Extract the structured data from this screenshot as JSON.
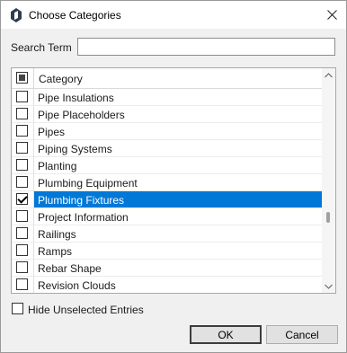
{
  "window": {
    "title": "Choose Categories",
    "icon": "app-logo-icon",
    "close_icon": "close-icon"
  },
  "search": {
    "label": "Search Term",
    "value": ""
  },
  "list": {
    "header": {
      "select_all_state": "indeterminate",
      "column_label": "Category"
    },
    "rows": [
      {
        "label": "Pipe Insulations",
        "checked": false,
        "selected": false
      },
      {
        "label": "Pipe Placeholders",
        "checked": false,
        "selected": false
      },
      {
        "label": "Pipes",
        "checked": false,
        "selected": false
      },
      {
        "label": "Piping Systems",
        "checked": false,
        "selected": false
      },
      {
        "label": "Planting",
        "checked": false,
        "selected": false
      },
      {
        "label": "Plumbing Equipment",
        "checked": false,
        "selected": false
      },
      {
        "label": "Plumbing Fixtures",
        "checked": true,
        "selected": true
      },
      {
        "label": "Project Information",
        "checked": false,
        "selected": false
      },
      {
        "label": "Railings",
        "checked": false,
        "selected": false
      },
      {
        "label": "Ramps",
        "checked": false,
        "selected": false
      },
      {
        "label": "Rebar Shape",
        "checked": false,
        "selected": false
      },
      {
        "label": "Revision Clouds",
        "checked": false,
        "selected": false
      }
    ],
    "selection_color": "#0078d7"
  },
  "hide_unselected": {
    "label": "Hide Unselected Entries",
    "checked": false
  },
  "buttons": {
    "ok": "OK",
    "cancel": "Cancel"
  }
}
